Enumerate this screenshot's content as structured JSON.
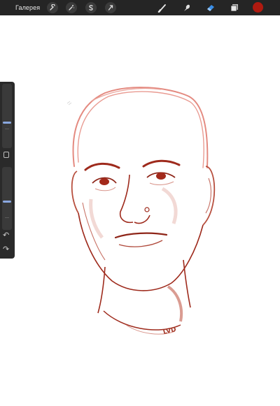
{
  "topbar": {
    "gallery_label": "Галерея",
    "actions": [
      {
        "name": "wrench-icon"
      },
      {
        "name": "magic-wand-icon"
      },
      {
        "name": "selection-s-icon"
      },
      {
        "name": "transform-arrow-icon"
      }
    ],
    "tools": [
      {
        "name": "brush-icon"
      },
      {
        "name": "smudge-icon"
      },
      {
        "name": "eraser-icon",
        "color": "#3a8ee6"
      },
      {
        "name": "layers-icon"
      }
    ],
    "current_color": "#b01a10"
  },
  "sidebar": {
    "brush_size_icon": "brush-size-slider",
    "opacity_icon": "opacity-slider",
    "modify_button_icon": "square-modify-icon",
    "undo_icon": "undo-icon",
    "redo_icon": "redo-icon",
    "undo_glyph": "↶",
    "redo_glyph": "↷"
  },
  "canvas": {
    "signature": "LVD",
    "stroke_color": "#9e2a1c",
    "light_stroke_color": "#e48a80"
  }
}
